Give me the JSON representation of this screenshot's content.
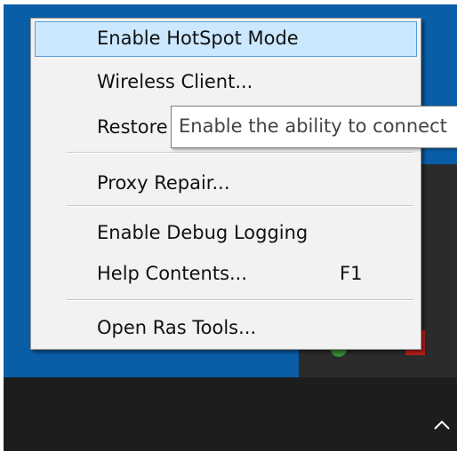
{
  "context_menu": {
    "items": [
      {
        "label": "Enable HotSpot Mode",
        "selected": true
      },
      {
        "label": "Wireless Client..."
      },
      {
        "label": "Restore"
      },
      {
        "label": "Proxy Repair..."
      },
      {
        "label": "Enable Debug Logging"
      },
      {
        "label": "Help Contents...",
        "shortcut": "F1"
      },
      {
        "label": "Open Ras Tools..."
      }
    ]
  },
  "tooltip": {
    "text": "Enable the ability to connect"
  },
  "taskbar": {
    "tray_chevron_icon": "chevron-up-icon"
  },
  "colors": {
    "desktop": "#0a5ea8",
    "taskbar": "#1d1d1d",
    "menu_bg": "#f2f2f2",
    "selection": "#cce8ff",
    "selection_border": "#5a9bd8"
  }
}
